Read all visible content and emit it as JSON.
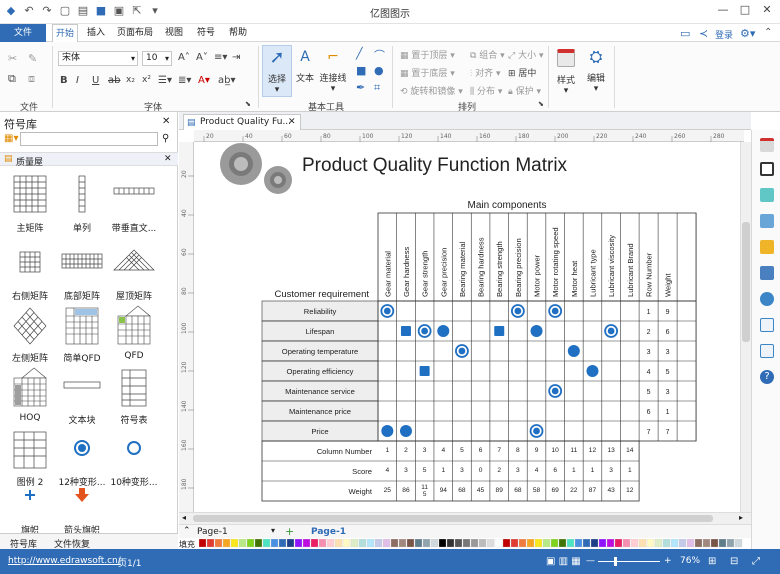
{
  "window": {
    "title": "亿图图示",
    "minimize": "—",
    "maximize": "□",
    "close": "✕"
  },
  "menu": {
    "file": "文件",
    "tabs": [
      "开始",
      "插入",
      "页面布局",
      "视图",
      "符号",
      "帮助"
    ],
    "login": "登录"
  },
  "ribbon": {
    "font_name": "宋体",
    "font_size": "10",
    "group_file": "文件",
    "group_font": "字体",
    "group_basic": "基本工具",
    "group_arrange": "排列",
    "select": "选择",
    "text": "文本",
    "connector": "连接线",
    "bring_front": "置于顶层",
    "send_back": "置于底层",
    "rotate_mirror": "旋转和镜像",
    "group": "组合",
    "align": "对齐",
    "distribute": "分布",
    "size": "大小",
    "center": "居中",
    "protect": "保护",
    "style": "样式",
    "edit": "编辑"
  },
  "sidebar": {
    "title": "符号库",
    "library": "质量屋",
    "symbols": [
      "主矩阵",
      "单列",
      "带垂直文...",
      "右侧矩阵",
      "底部矩阵",
      "屋顶矩阵",
      "左侧矩阵",
      "简单QFD",
      "QFD",
      "HOQ",
      "文本块",
      "符号表",
      "图例 2",
      "12种变形...",
      "10种变形...",
      "旗帜",
      "箭头旗帜"
    ],
    "tabs": [
      "符号库",
      "文件恢复"
    ]
  },
  "document": {
    "tab": "Product Quality Fu...",
    "page_tab": "Page-1",
    "page_active": "Page-1",
    "fill_label": "填充"
  },
  "ruler": {
    "h_ticks": [
      "20",
      "40",
      "60",
      "80",
      "100",
      "120",
      "140",
      "160",
      "180",
      "200",
      "220",
      "240",
      "260",
      "280"
    ],
    "v_ticks": [
      "20",
      "40",
      "60",
      "80",
      "100",
      "120",
      "140",
      "160",
      "180"
    ]
  },
  "matrix": {
    "title": "Product Quality Function Matrix",
    "top_header": "Main components",
    "row_header": "Customer requirement",
    "columns": [
      "Gear material",
      "Gear hardness",
      "Gear strength",
      "Gear precision",
      "Bearing material",
      "Bearing hardness",
      "Bearing strength",
      "Bearing precision",
      "Motor power",
      "Motor rotating speed",
      "Motor heat",
      "Lubricant type",
      "Lubricant viscosity",
      "Lubricant Brand"
    ],
    "extra_columns": [
      "Row Number",
      "Weight"
    ],
    "rows": [
      {
        "label": "Reliability",
        "num": "1",
        "weight": "9"
      },
      {
        "label": "Lifespan",
        "num": "2",
        "weight": "6"
      },
      {
        "label": "Operating temperature",
        "num": "3",
        "weight": "3"
      },
      {
        "label": "Operating efficiency",
        "num": "4",
        "weight": "5"
      },
      {
        "label": "Maintenance service",
        "num": "5",
        "weight": "3"
      },
      {
        "label": "Maintenance price",
        "num": "6",
        "weight": "1"
      },
      {
        "label": "Price",
        "num": "7",
        "weight": "7"
      }
    ],
    "marks": [
      [
        0,
        0,
        "ring"
      ],
      [
        0,
        7,
        "ring"
      ],
      [
        0,
        9,
        "ring"
      ],
      [
        1,
        1,
        "square"
      ],
      [
        1,
        2,
        "ring"
      ],
      [
        1,
        3,
        "dot"
      ],
      [
        1,
        6,
        "square"
      ],
      [
        1,
        8,
        "dot"
      ],
      [
        1,
        12,
        "ring"
      ],
      [
        2,
        4,
        "ring"
      ],
      [
        2,
        10,
        "dot"
      ],
      [
        3,
        2,
        "square"
      ],
      [
        3,
        11,
        "dot"
      ],
      [
        4,
        9,
        "ring"
      ],
      [
        6,
        0,
        "dot"
      ],
      [
        6,
        1,
        "dot"
      ],
      [
        6,
        8,
        "ring"
      ]
    ],
    "footer": [
      {
        "label": "Column Number",
        "values": [
          "1",
          "2",
          "3",
          "4",
          "5",
          "6",
          "7",
          "8",
          "9",
          "10",
          "11",
          "12",
          "13",
          "14"
        ]
      },
      {
        "label": "Score",
        "values": [
          "4",
          "3",
          "5",
          "1",
          "3",
          "0",
          "2",
          "3",
          "4",
          "6",
          "1",
          "1",
          "3",
          "1"
        ]
      },
      {
        "label": "Weight",
        "values": [
          "25",
          "86",
          "11\n5",
          "94",
          "68",
          "45",
          "89",
          "68",
          "58",
          "69",
          "22",
          "87",
          "43",
          "12"
        ]
      }
    ]
  },
  "status": {
    "url": "http://www.edrawsoft.cn/",
    "page": "页1/1",
    "zoom": "76%"
  },
  "colors": {
    "accent": "#2f6cb5",
    "mark": "#1f6fc2",
    "grid": "#333333"
  }
}
